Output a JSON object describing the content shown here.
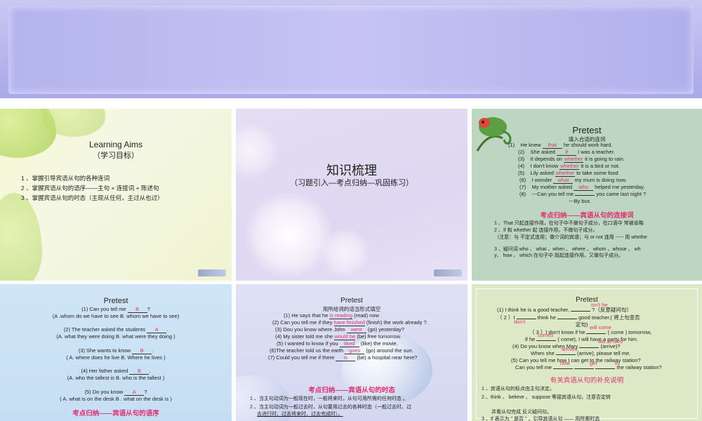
{
  "slide1": {
    "title": "Learning  Aims",
    "subtitle": "（学习目标）",
    "items": [
      "1 、掌握引导宾语从句的各种连词",
      "2 、掌握宾语从句的语序——主句 + 连接词 + 陈述句",
      "3 、掌握宾语从句的时态（主现从任何，主过从也过）"
    ]
  },
  "slide2": {
    "title": "知识梳理",
    "subtitle": "（习题引入—考点归纳—巩固练习）"
  },
  "slide3": {
    "title": "Pretest",
    "instruction": "填入合适的连词",
    "lines": [
      {
        "num": "(1)",
        "pre": "He  knew",
        "ans": "that",
        "post": "he  should  work  hard."
      },
      {
        "num": "(2)",
        "pre": "She  asked",
        "ans": "if",
        "post": "I was a teacher."
      },
      {
        "num": "(3)",
        "pre": "It  depends on",
        "ans": "whether",
        "post": "it is going to rain."
      },
      {
        "num": "(4)",
        "pre": "I don't know",
        "ans": "whether",
        "post": "it is a bird or not."
      },
      {
        "num": "(5)",
        "pre": "Lily asked",
        "ans": "whether",
        "post": "to take some food"
      },
      {
        "num": "(6)",
        "pre": "I wonder",
        "ans": "what",
        "post": "my mum is doing now."
      },
      {
        "num": "(7)",
        "pre": "My mother asked",
        "ans": "who",
        "post": "helped me yesterday."
      },
      {
        "num": "(8)",
        "pre": "---Can you tell me",
        "ans": "",
        "post": "you came last night ?"
      }
    ],
    "line9": "---By bus",
    "heading": "考点归纳——宾语从句的连接词",
    "notes": [
      "1 、That  只起连接作用，在句子中不做句子成分，在口语中 常被省略",
      "2 、If  和   whether  起  连接作用，不做句子成分。",
      "（注意：与  不定式连用；做介词的宾语；与    or not  连用 ----- 用    whethe",
      "3 、疑问词   who 、    what  、when 、    where  、 whom  、whose  、 wh",
      "y、    how  、                which  在句子中 既起连接作用，又做句子成分。"
    ]
  },
  "slide4": {
    "title": "Pretest",
    "q1": "(1)       Can you tell me",
    "q1ans": "B",
    "q1post": "?",
    "q1opt": "(A .whom do we have to see     B. whom we have to see)",
    "q2": "(2)  The teacher asked the students",
    "q2ans": "A",
    "q2post": ".",
    "q2opt": "(A. what they were doing   B. what  were they doing )",
    "q3": "(3)     She wants to know",
    "q3ans": "B",
    "q3post": ".",
    "q3opt": "(    A. where     does     he   live   B.   Where   he   lives )",
    "q4": "(4)  Her father asked",
    "q4ans": "B",
    "q4post": ".",
    "q4opt": "(A. who  the tallest is   B. who is the tallest )",
    "q5": "(5) Do you know",
    "q5ans": "A",
    "q5post": "?",
    "q5opt": "(   A. what is on the desk    B . what on the desk is )",
    "heading": "考点归纳——宾语从句的语序"
  },
  "slide5": {
    "title": "Pretest",
    "instruction": "用所给词的适当形式填空",
    "lines": [
      {
        "pre": "(1) He   says  that  he",
        "ans": "is reading",
        "post": "(read) now ."
      },
      {
        "pre": "(2) Can you tell me if they",
        "ans": "have finished",
        "post": "(finish) the work  already ?."
      },
      {
        "pre": "(3)   Dou you know where John",
        "ans": "went",
        "post": "(go) yesterday?"
      },
      {
        "pre": "(4) My sister told me she",
        "ans": "would be",
        "post": "(be) free tomorrow."
      },
      {
        "pre": "(5) I wanted to know if you",
        "ans": "liked",
        "post": "(like) the movie."
      },
      {
        "pre": "(6)The teacher told us the earth",
        "ans": "goes",
        "post": "(go) around the sun."
      },
      {
        "pre": "(7) Could you tell me if there",
        "ans": "is",
        "post": "(be) a hospital near here?"
      }
    ],
    "heading": "考点归纳——宾语从句的时态",
    "notes": [
      "1 、当主句动词为一般现在时，一般将来时，从句可用所需的任何时态 。",
      "2 、当主句动词为一般过去时，从句要用过去的各种时态（一般过去时、过",
      "去进行时、过去将来时、过去完成时）。"
    ]
  },
  "slide6": {
    "title": "Pretest",
    "lines": [
      "(1)       I think he is a good teacher,",
      "（   2 ）I",
      "（ 3 ）I don't   know if  he",
      "if he",
      "(4)    Do you know when Mary",
      "When she",
      "(5) Can you tell me how I can get to the railway station?",
      "Can you tell me"
    ],
    "ans": [
      "isn't  he",
      "don't",
      "will come",
      "comes",
      "will arrives",
      "arrives",
      "how",
      "get",
      "to"
    ],
    "fill1": "?（反意疑问句）",
    "fill2": "think  he",
    "fill2b": "good teacher.( 将上句变否",
    "fill2c": "定句)",
    "fill3": "( come ) tomorrow,",
    "fill4": "( come), I will have a party for him.",
    "fill5": "(arrive)?",
    "fill6": "(arrive), please tell me.",
    "fill8": "the railway station?",
    "heading": "有关宾语从句的补充说明",
    "notes": [
      "1 、宾语从句的标点由主句决定。",
      "2 、think 、 believe  、 suppose  等接宾语从句，注意否定转",
      "",
      "并看从句完成  反义疑问句。",
      "3 、If 表示为 \" 是否 \" ，引导宾语从句 —— 用所需时态"
    ]
  }
}
